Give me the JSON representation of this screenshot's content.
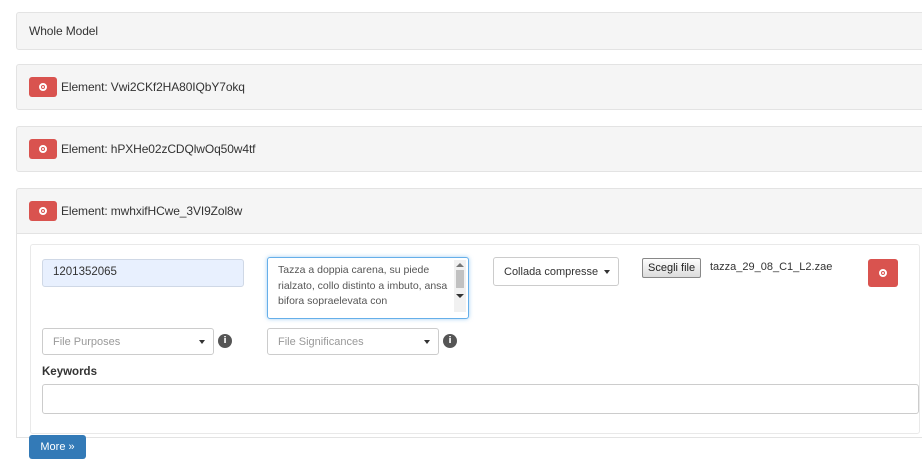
{
  "panels": {
    "whole_model": "Whole Model",
    "elements": [
      {
        "label": "Element: Vwi2CKf2HA80IQbY7okq"
      },
      {
        "label": "Element: hPXHe02zCDQlwOq50w4tf"
      },
      {
        "label": "Element: mwhxifHCwe_3VI9Zol8w"
      }
    ]
  },
  "form": {
    "inventory_number": "1201352065",
    "description": "Tazza a doppia carena, su piede rialzato, collo distinto a imbuto, ansa bifora sopraelevata con",
    "type_select": "Collada compresse",
    "file_button": "Scegli file",
    "file_name": "tazza_29_08_C1_L2.zae",
    "file_purposes_placeholder": "File Purposes",
    "file_significances_placeholder": "File Significances",
    "info_glyph": "i",
    "keywords_label": "Keywords",
    "keywords_value": "",
    "more_button": "More »"
  },
  "colors": {
    "danger": "#d9534f",
    "primary": "#337ab7",
    "panel_bg": "#f5f5f5"
  }
}
